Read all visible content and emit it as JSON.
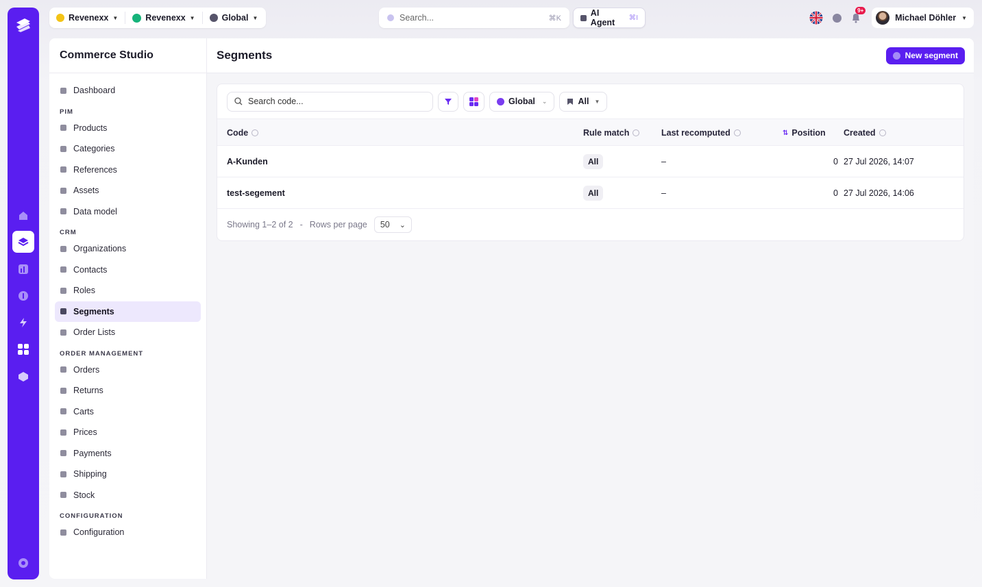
{
  "colors": {
    "brand": "#5a1ef0",
    "active_bg": "#ede8fd",
    "badge": "#e8194b",
    "ctx1_dot": "#f3c316",
    "ctx2_dot": "#16b37a"
  },
  "topbar": {
    "contexts": [
      {
        "label": "Revenexx",
        "icon": "revenexx-logo-icon"
      },
      {
        "label": "Revenexx",
        "icon": "green-dot-icon"
      },
      {
        "label": "Global",
        "icon": "globe-icon"
      }
    ],
    "search": {
      "placeholder": "Search...",
      "shortcut": "⌘K"
    },
    "agent": {
      "label": "AI Agent",
      "shortcut": "⌘I"
    },
    "notifications": {
      "badge": "9+"
    },
    "user": {
      "name": "Michael Döhler"
    }
  },
  "sidebar": {
    "title": "Commerce Studio",
    "entries": [
      {
        "type": "item",
        "label": "Dashboard",
        "icon": "dashboard-icon"
      },
      {
        "type": "section",
        "label": "PIM"
      },
      {
        "type": "item",
        "label": "Products",
        "icon": "box-icon"
      },
      {
        "type": "item",
        "label": "Categories",
        "icon": "category-icon"
      },
      {
        "type": "item",
        "label": "References",
        "icon": "database-icon"
      },
      {
        "type": "item",
        "label": "Assets",
        "icon": "image-icon"
      },
      {
        "type": "item",
        "label": "Data model",
        "icon": "grid-icon"
      },
      {
        "type": "section",
        "label": "CRM"
      },
      {
        "type": "item",
        "label": "Organizations",
        "icon": "box-icon"
      },
      {
        "type": "item",
        "label": "Contacts",
        "icon": "box-icon"
      },
      {
        "type": "item",
        "label": "Roles",
        "icon": "shield-icon"
      },
      {
        "type": "item",
        "label": "Segments",
        "icon": "users-icon",
        "active": true
      },
      {
        "type": "item",
        "label": "Order Lists",
        "icon": "bookmark-icon"
      },
      {
        "type": "section",
        "label": "ORDER MANAGEMENT"
      },
      {
        "type": "item",
        "label": "Orders",
        "icon": "box-icon"
      },
      {
        "type": "item",
        "label": "Returns",
        "icon": "return-icon"
      },
      {
        "type": "item",
        "label": "Carts",
        "icon": "cart-icon"
      },
      {
        "type": "item",
        "label": "Prices",
        "icon": "tag-icon"
      },
      {
        "type": "item",
        "label": "Payments",
        "icon": "card-icon"
      },
      {
        "type": "item",
        "label": "Shipping",
        "icon": "truck-icon"
      },
      {
        "type": "item",
        "label": "Stock",
        "icon": "box-icon"
      },
      {
        "type": "section",
        "label": "CONFIGURATION"
      },
      {
        "type": "item",
        "label": "Configuration",
        "icon": "gear-icon"
      }
    ]
  },
  "main": {
    "title": "Segments",
    "new_button": "New segment",
    "filters": {
      "search_placeholder": "Search code...",
      "scope": "Global",
      "type": "All"
    },
    "table": {
      "columns": {
        "code": "Code",
        "rule_match": "Rule match",
        "last_recomputed": "Last recomputed",
        "position": "Position",
        "created": "Created"
      },
      "rows": [
        {
          "code": "A-Kunden",
          "rule_match": "All",
          "last_recomputed": "–",
          "position": "0",
          "created": "27 Jul 2026, 14:07"
        },
        {
          "code": "test-segement",
          "rule_match": "All",
          "last_recomputed": "–",
          "position": "0",
          "created": "27 Jul 2026, 14:06"
        }
      ]
    },
    "footer": {
      "showing": "Showing 1–2 of 2",
      "separator": "-",
      "rows_label": "Rows per page",
      "rows_value": "50"
    }
  }
}
